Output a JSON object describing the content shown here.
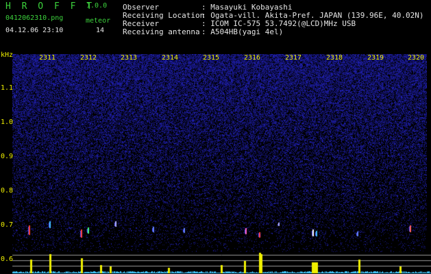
{
  "header": {
    "app_title": "H R O F F T",
    "version": "1.0.0",
    "filename": "0412062310.png",
    "datetime": "04.12.06 23:10",
    "meteor_label": "meteor",
    "meteor_count": "14",
    "observer_label": "Observer",
    "observer_value": ": Masayuki Kobayashi",
    "location_label": "Receiving Location",
    "location_value": ": Ogata-vill. Akita-Pref. JAPAN (139.96E, 40.02N)",
    "receiver_label": "Receiver",
    "receiver_value": ": ICOM IC-575 53.7492(@LCD)MHz USB",
    "antenna_label": "Receiving antenna",
    "antenna_value": ": A504HB(yagi 4el)"
  },
  "spectrogram": {
    "y_unit": "kHz",
    "y_ticks": [
      "1.1",
      "1.0",
      "0.9",
      "0.8",
      "0.7",
      "0.6"
    ],
    "x_ticks": [
      "2311",
      "2312",
      "2313",
      "2314",
      "2315",
      "2316",
      "2317",
      "2318",
      "2319",
      "2320"
    ],
    "colors": {
      "background": "#000000",
      "noise": "#1a1aa0",
      "text_green": "#3cd23c",
      "text_yellow": "#f0f000",
      "meteor_bar": "#f0f000",
      "baseline": "#40c8ff"
    }
  }
}
